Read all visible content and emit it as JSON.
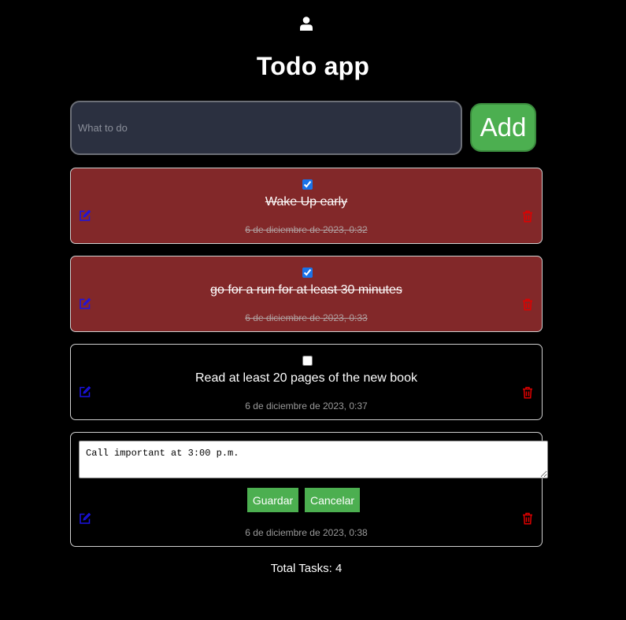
{
  "header": {
    "user_icon": "user-icon",
    "title": "Todo app"
  },
  "form": {
    "input_placeholder": "What to do",
    "input_value": "",
    "add_label": "Add"
  },
  "todos": [
    {
      "text": "Wake Up early",
      "date": "6 de diciembre de 2023, 0:32",
      "completed": true
    },
    {
      "text": "go for a run for at least 30 minutes",
      "date": "6 de diciembre de 2023, 0:33",
      "completed": true
    },
    {
      "text": "Read at least 20 pages of the new book",
      "date": "6 de diciembre de 2023, 0:37",
      "completed": false
    },
    {
      "editing": true,
      "edit_value": "Call important at 3:00 p.m.",
      "save_label": "Guardar",
      "cancel_label": "Cancelar",
      "date": "6 de diciembre de 2023, 0:38"
    }
  ],
  "footer": {
    "total_text": "Total Tasks: 4"
  },
  "colors": {
    "background": "#000000",
    "completed_card": "#822829",
    "input_bg": "#2b3040",
    "add_button": "#4caf50",
    "edit_icon": "#1a12e6",
    "delete_icon": "#e00000"
  }
}
